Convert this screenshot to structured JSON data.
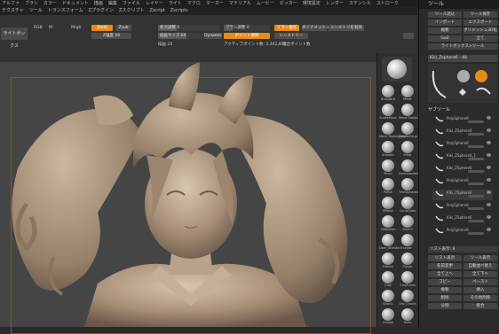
{
  "menubar": [
    "アルファ",
    "ブラシ",
    "カラー",
    "ドキュメント",
    "描画",
    "編集",
    "ファイル",
    "レイヤー",
    "ライト",
    "マクロ",
    "マーカー",
    "マテリアル",
    "ムービー",
    "ピッカー",
    "環境設定",
    "レンダー",
    "ステンシル",
    "ストローク"
  ],
  "menubar2": [
    "テクスチャ",
    "ツール",
    "トランスフォーム",
    "Zプラグイン",
    "Zスクリプト",
    "Zscript",
    "Zscripts"
  ],
  "toolbar": {
    "lightbox": "ライトボックス",
    "rgb": "RGB",
    "m": "M",
    "mrgb": "Mrgb",
    "zadd": "Zadd",
    "zsub": "Zsub",
    "zcut": "Z強度 26",
    "focal": "焦点調整 0",
    "drawsize": "描画サイズ 64",
    "brushsize": "ブラシ調整 0",
    "dynamic": "Dynamic",
    "point": "ポイント選択",
    "mirror": "ミラー復元",
    "dynamesh": "ダイナメッシュ",
    "symmetry": "シンメトリー",
    "actpoints": "アクティブポイント数: 2,342,875",
    "totalpoints": "総合ポイント数",
    "sync": "シンメトリを有効",
    "brush_label": "描画 24"
  },
  "tray": {
    "title": "ツール",
    "buttons": [
      "ツール読込",
      "ツール保存",
      "インポート",
      "エクスポート",
      "複製",
      "ポリメッシュ3D化",
      "GoZ",
      "全て",
      "ライトボックス>ツール"
    ],
    "current_tool": "Kiki_Zsphere6 - 48",
    "subtool_header": "サブツール",
    "subtools": [
      "PolySphere6",
      "Kiki_ZSphere6",
      "PolySphere6",
      "Kiki_ZSphere6_1",
      "Kiki_ZSphere6",
      "PolySphere6",
      "Kiki_ZSphere6",
      "PolySphere6",
      "Kiki_ZSphere6",
      "PolySphere6"
    ],
    "bottom_buttons": [
      "リスト表示",
      "ツール表示",
      "名前変更",
      "自動並べ替え",
      "全て上へ",
      "全て下へ",
      "コピー",
      "ペースト",
      "複製",
      "挿入",
      "削除",
      "その他削除",
      "分割",
      "統合"
    ],
    "slider_label": "リスト表示: 8"
  },
  "shelf": {
    "brushes": [
      "Standard",
      "Move",
      "SnakeHook",
      "Move Elastic",
      "Move Topological",
      "ClayBuildup",
      "Smooth",
      "Inflat",
      "Pinch",
      "DamStandard",
      "Polish",
      "TrimDynamic",
      "hPolish",
      "CurveTube",
      "ZModeler",
      "Slash3",
      "Dam_Standard",
      "Layer",
      "Flatten",
      "Planar",
      "Clay",
      "ClayTubes",
      "Slash1",
      "Orb_Cracks",
      "Crease",
      "Form"
    ]
  },
  "colors": {
    "accent": "#e88a1a",
    "clay": "#b09a80"
  }
}
